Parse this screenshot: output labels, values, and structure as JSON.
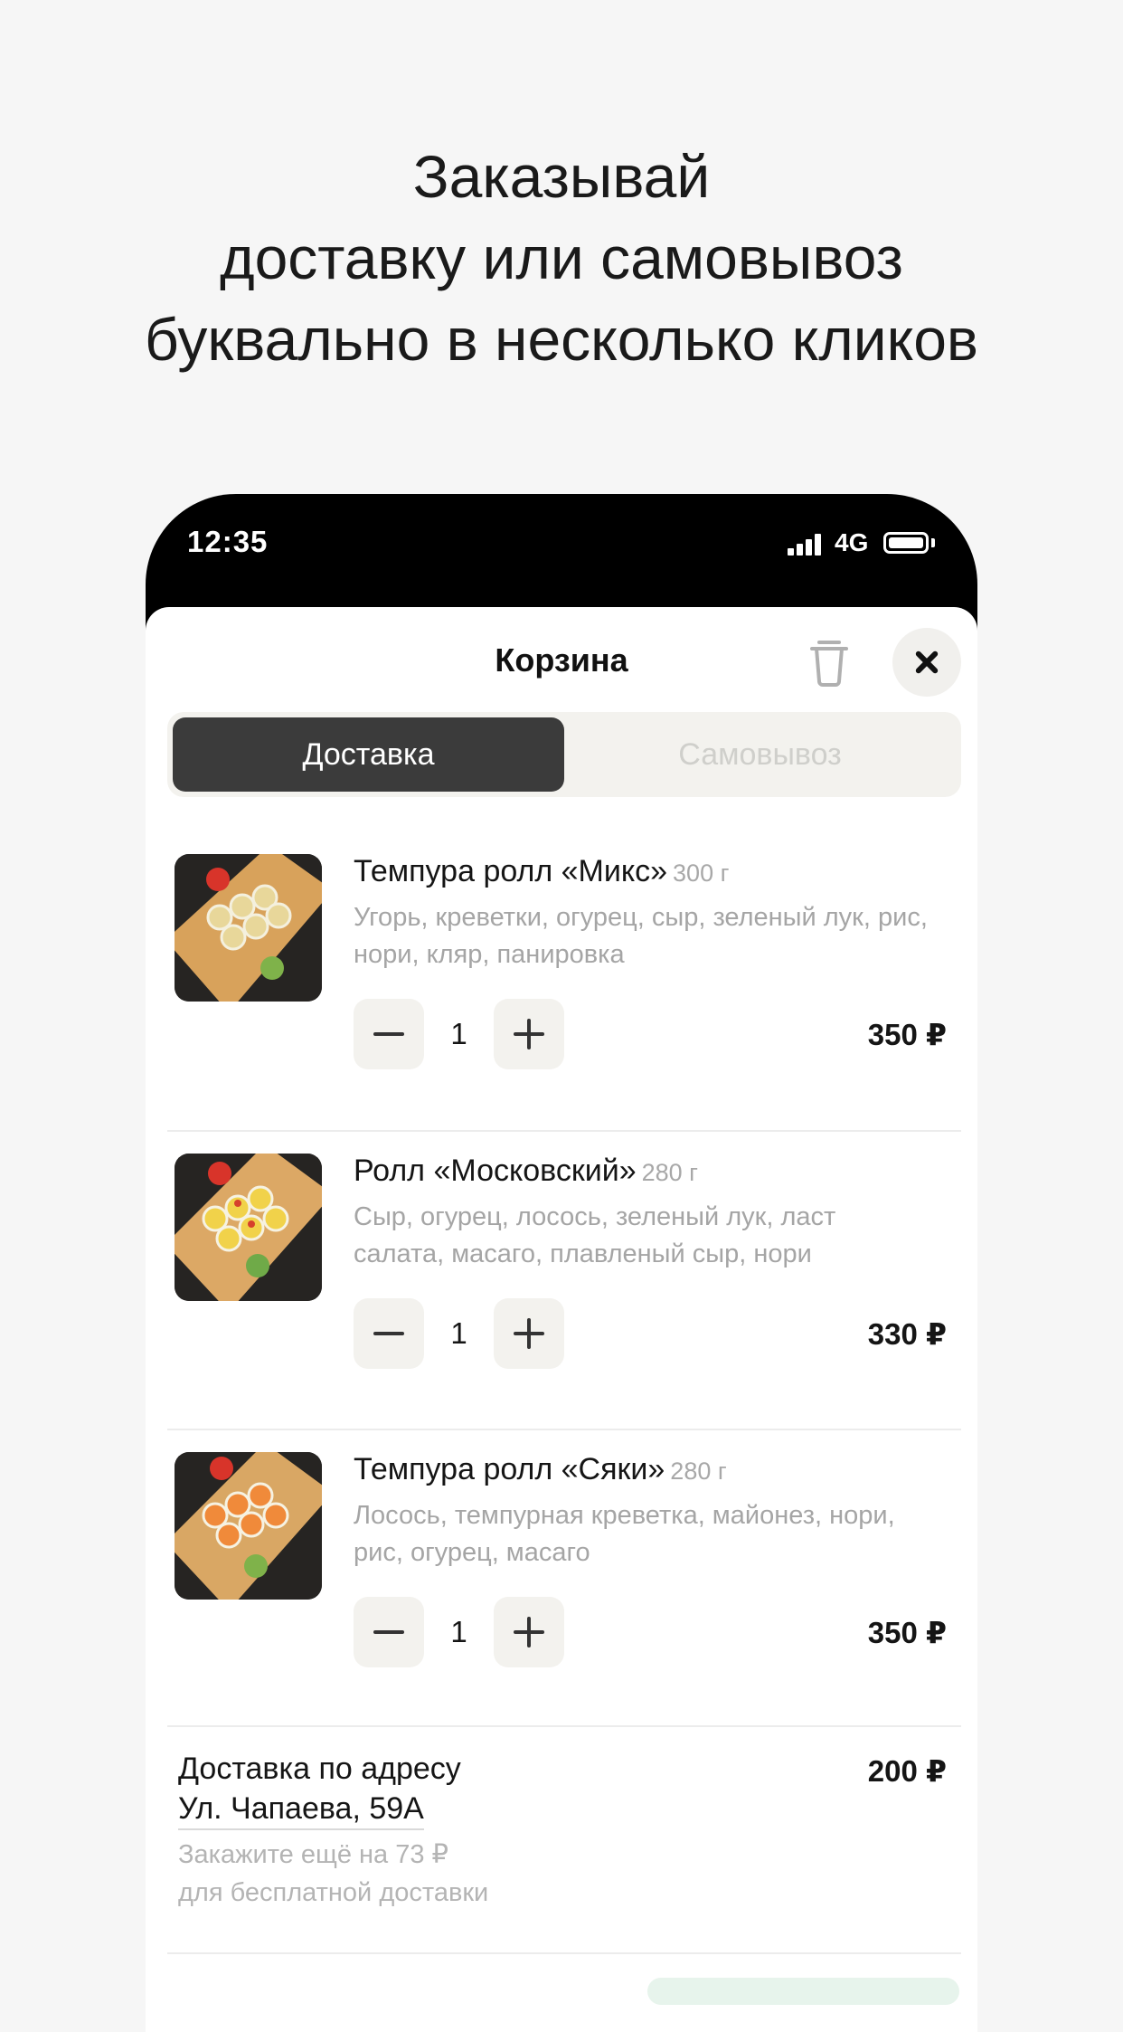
{
  "headline": {
    "line1": "Заказывай",
    "line2": "доставку или самовывоз",
    "line3": "буквально в несколько кликов"
  },
  "status_bar": {
    "time": "12:35",
    "network": "4G"
  },
  "cart": {
    "title": "Корзина",
    "tabs": [
      {
        "label": "Доставка",
        "active": true
      },
      {
        "label": "Самовывоз",
        "active": false
      }
    ],
    "items": [
      {
        "name": "Темпура ролл «Микс»",
        "weight": "300 г",
        "description": "Угорь, креветки, огурец, сыр, зеленый лук, рис, нори, кляр, панировка",
        "quantity": "1",
        "price": "350 ₽"
      },
      {
        "name": "Ролл «Московский»",
        "weight": "280 г",
        "description": "Сыр, огурец, лосось, зеленый лук, ласт салата, масаго, плавленый сыр, нори",
        "quantity": "1",
        "price": "330 ₽"
      },
      {
        "name": "Темпура ролл «Сяки»",
        "weight": "280 г",
        "description": "Лосось, темпурная креветка, майонез, нори, рис, огурец, масаго",
        "quantity": "1",
        "price": "350 ₽"
      }
    ],
    "delivery": {
      "label": "Доставка по адресу",
      "address": "Ул. Чапаева, 59А",
      "price": "200 ₽",
      "hint_line1": "Закажите ещё на 73 ₽",
      "hint_line2": "для бесплатной доставки"
    }
  },
  "colors": {
    "background": "#f6f6f6",
    "active_tab": "#3b3b3b",
    "button_bg": "#f3f2ee",
    "muted_text": "#a5a5a5"
  }
}
